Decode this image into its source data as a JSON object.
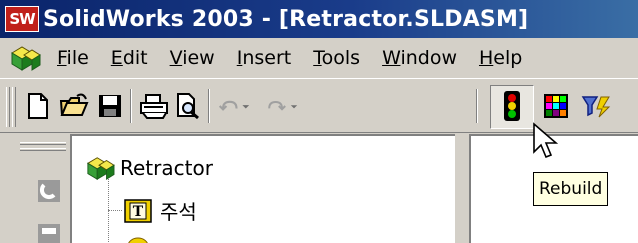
{
  "window": {
    "app_icon_text": "SW",
    "title": "SolidWorks 2003 - [Retractor.SLDASM]"
  },
  "menu": {
    "items": [
      {
        "first": "F",
        "rest": "ile"
      },
      {
        "first": "E",
        "rest": "dit"
      },
      {
        "first": "V",
        "rest": "iew"
      },
      {
        "first": "I",
        "rest": "nsert"
      },
      {
        "first": "T",
        "rest": "ools"
      },
      {
        "first": "W",
        "rest": "indow"
      },
      {
        "first": "H",
        "rest": "elp"
      }
    ]
  },
  "toolbar": {
    "buttons": [
      "new-document-icon",
      "open-folder-icon",
      "save-icon",
      "print-icon",
      "print-preview-icon",
      "undo-icon",
      "redo-icon",
      "rebuild-traffic-light-icon",
      "color-palette-icon",
      "filter-icon"
    ]
  },
  "tree": {
    "root_label": "Retractor",
    "items": [
      {
        "label": "주석",
        "icon": "annotation-icon"
      }
    ]
  },
  "tooltip": {
    "text": "Rebuild"
  },
  "colors": {
    "title_bar": "#0a246a",
    "face": "#d4d0c8",
    "app_icon": "#c0201a",
    "tooltip_bg": "#ffffe1"
  }
}
